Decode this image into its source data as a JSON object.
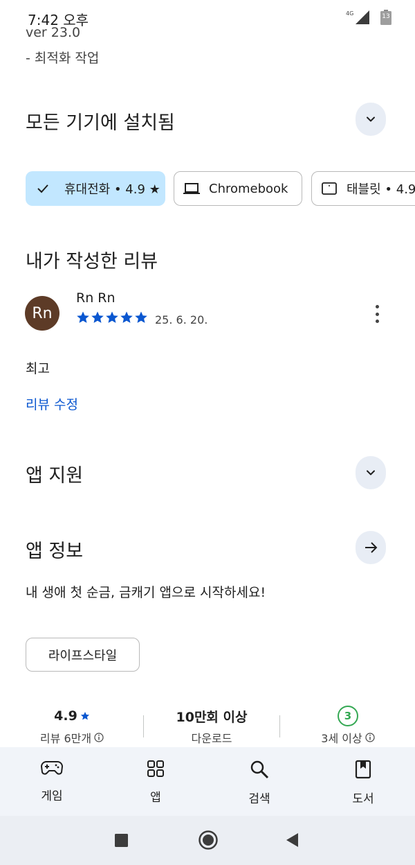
{
  "status_bar": {
    "time": "7:42 오후",
    "network": "4G",
    "battery": "13"
  },
  "whats_new": {
    "version": "ver 23.0",
    "lines": [
      "- 최적화 작업"
    ]
  },
  "installed": {
    "title": "모든 기기에 설치됨",
    "icon": "chevron-down-icon",
    "devices": [
      {
        "label": "휴대전화 • 4.9 ★",
        "icon": "check-icon",
        "selected": true
      },
      {
        "label": "Chromebook",
        "icon": "laptop-icon",
        "selected": false
      },
      {
        "label": "태블릿 • 4.9 ★",
        "icon": "tablet-icon",
        "selected": false
      }
    ]
  },
  "my_review": {
    "title": "내가 작성한 리뷰",
    "avatar_initials": "Rn",
    "author": "Rn Rn",
    "rating": 5,
    "date": "25. 6. 20.",
    "body": "최고",
    "edit_label": "리뷰 수정"
  },
  "app_support": {
    "title": "앱 지원",
    "icon": "chevron-down-icon"
  },
  "app_info": {
    "title": "앱 정보",
    "icon": "arrow-right-icon",
    "description": "내 생애 첫 순금, 금캐기 앱으로 시작하세요!",
    "category": "라이프스타일"
  },
  "stats": {
    "rating": {
      "value": "4.9",
      "label": "리뷰 6만개"
    },
    "downloads": {
      "value": "10만회 이상",
      "label": "다운로드"
    },
    "age": {
      "value": "3",
      "label": "3세 이상"
    }
  },
  "bottom_nav": [
    {
      "label": "게임",
      "icon": "gamepad-icon"
    },
    {
      "label": "앱",
      "icon": "apps-grid-icon"
    },
    {
      "label": "검색",
      "icon": "search-icon"
    },
    {
      "label": "도서",
      "icon": "book-icon"
    }
  ],
  "colors": {
    "accent_blue": "#0b57d0",
    "selected_chip": "#c2e7ff",
    "round_button": "#e8edf5",
    "avatar": "#5d3b27",
    "age_badge": "#34a853",
    "nav_background": "#f1f4f9"
  }
}
